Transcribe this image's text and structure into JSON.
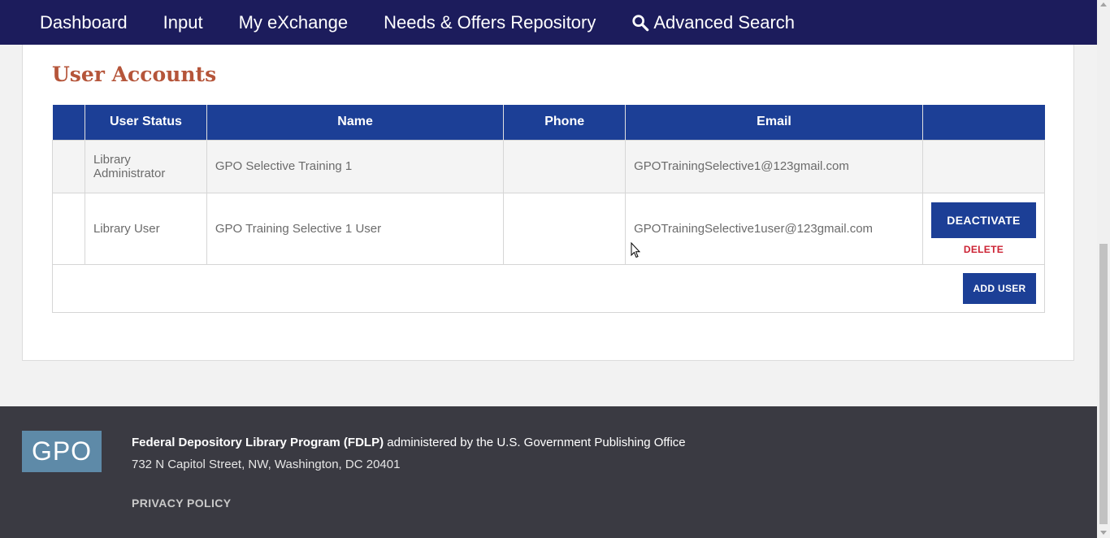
{
  "nav": {
    "items": [
      "Dashboard",
      "Input",
      "My eXchange",
      "Needs & Offers Repository"
    ],
    "search_label": "Advanced Search"
  },
  "page": {
    "title": "User Accounts"
  },
  "table": {
    "headers": [
      "",
      "User Status",
      "Name",
      "Phone",
      "Email",
      ""
    ],
    "rows": [
      {
        "status": "Library Administrator",
        "name": "GPO Selective Training 1",
        "phone": "",
        "email": "GPOTrainingSelective1@123gmail.com"
      },
      {
        "status": "Library User",
        "name": "GPO Training Selective 1 User",
        "phone": "",
        "email": "GPOTrainingSelective1user@123gmail.com",
        "deactivate_label": "DEACTIVATE",
        "delete_label": "DELETE"
      }
    ],
    "add_user_label": "ADD USER"
  },
  "footer": {
    "logo_text": "GPO",
    "program_name": "Federal Depository Library Program (FDLP)",
    "administered_by": " administered by the U.S. Government Publishing Office",
    "address": "732 N Capitol Street, NW, Washington, DC 20401",
    "privacy_label": "PRIVACY POLICY"
  },
  "colors": {
    "nav_bg": "#1c1c5c",
    "table_header": "#1c3f96",
    "title": "#b5553a",
    "delete": "#cc2233",
    "footer_bg": "#3a3a42",
    "logo_bg": "#5e8aa8"
  }
}
